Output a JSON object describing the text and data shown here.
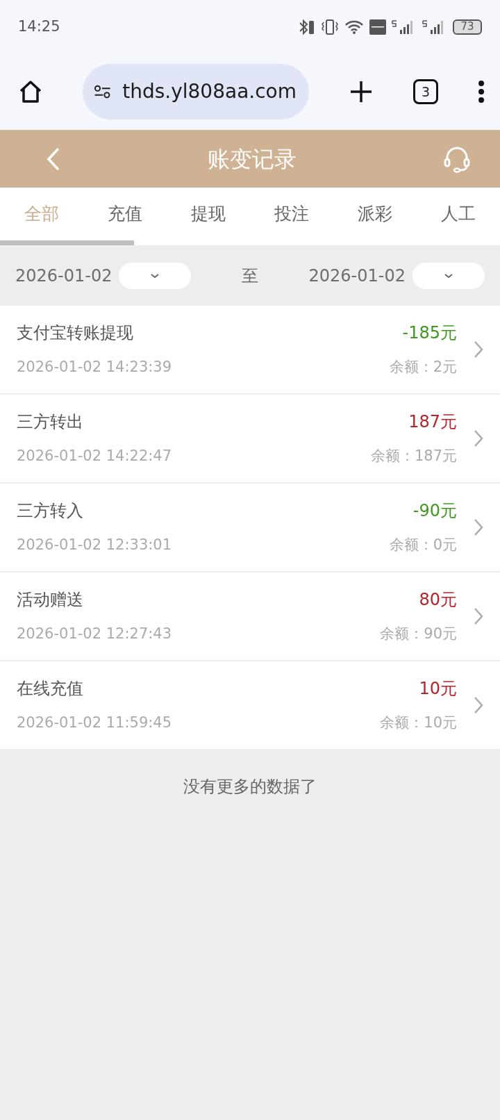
{
  "status_bar": {
    "time": "14:25",
    "battery": "73"
  },
  "browser": {
    "url": "thds.yl808aa.com",
    "tab_count": "3"
  },
  "header": {
    "title": "账变记录"
  },
  "tabs": [
    {
      "label": "全部",
      "selected": true
    },
    {
      "label": "充值",
      "selected": false
    },
    {
      "label": "提现",
      "selected": false
    },
    {
      "label": "投注",
      "selected": false
    },
    {
      "label": "派彩",
      "selected": false
    },
    {
      "label": "人工",
      "selected": false
    }
  ],
  "date_filter": {
    "start": "2026-01-02",
    "separator": "至",
    "end": "2026-01-02"
  },
  "records": [
    {
      "title": "支付宝转账提现",
      "time": "2026-01-02 14:23:39",
      "amount": "-185元",
      "color": "#3c9a1e",
      "balance": "余额：2元"
    },
    {
      "title": "三方转出",
      "time": "2026-01-02 14:22:47",
      "amount": "187元",
      "color": "#b7252a",
      "balance": "余额：187元"
    },
    {
      "title": "三方转入",
      "time": "2026-01-02 12:33:01",
      "amount": "-90元",
      "color": "#3c9a1e",
      "balance": "余额：0元"
    },
    {
      "title": "活动赠送",
      "time": "2026-01-02 12:27:43",
      "amount": "80元",
      "color": "#b7252a",
      "balance": "余额：90元"
    },
    {
      "title": "在线充值",
      "time": "2026-01-02 11:59:45",
      "amount": "10元",
      "color": "#b7252a",
      "balance": "余额：10元"
    }
  ],
  "footer": "没有更多的数据了"
}
